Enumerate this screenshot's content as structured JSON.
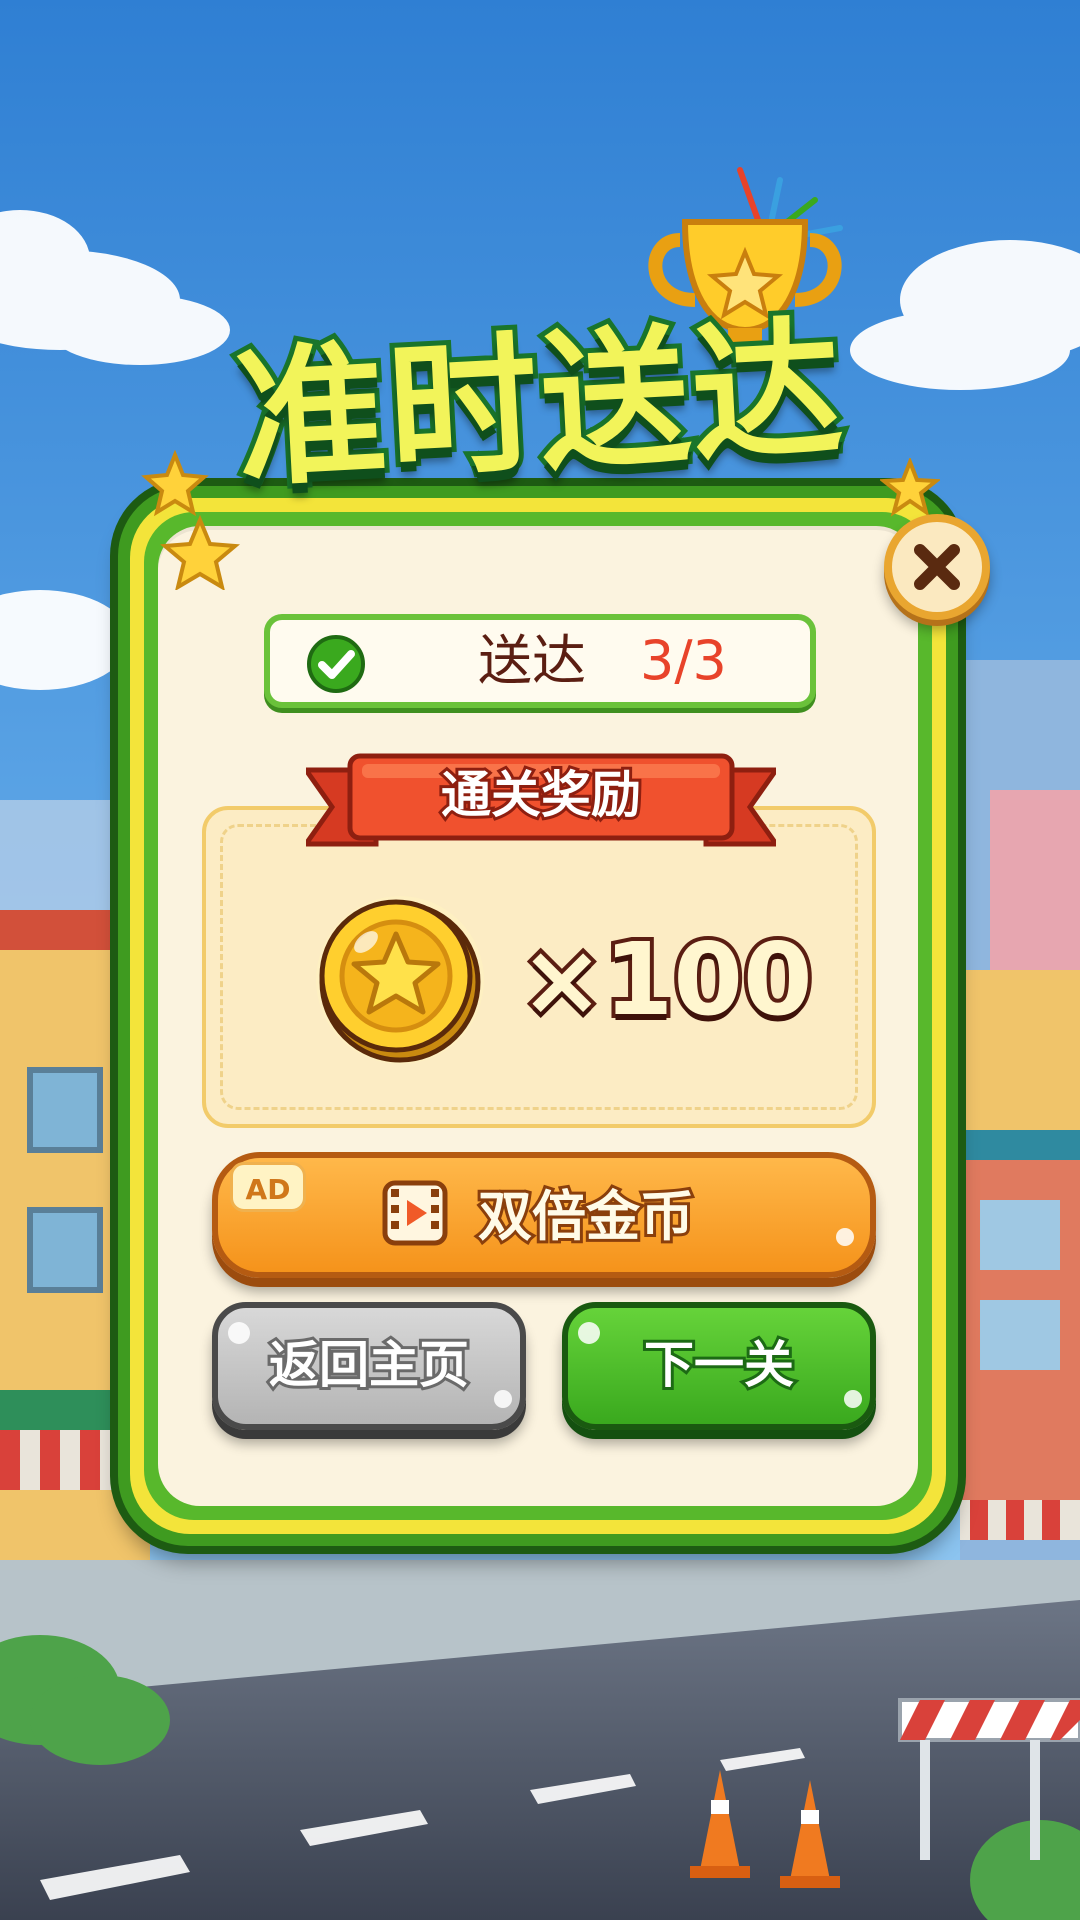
{
  "title": "准时送达",
  "status": {
    "label": "送达",
    "count": "3/3"
  },
  "reward": {
    "ribbon_label": "通关奖励",
    "amount": "×100"
  },
  "buttons": {
    "double": {
      "ad_badge": "AD",
      "label": "双倍金币"
    },
    "home": "返回主页",
    "next": "下一关"
  },
  "icons": {
    "close": "close-icon",
    "check": "check-icon",
    "coin": "star-coin-icon",
    "video": "video-play-icon",
    "trophy": "trophy-icon"
  },
  "colors": {
    "panel_green": "#58b82c",
    "panel_cream": "#fbf3df",
    "accent_orange": "#f5931b",
    "count_red": "#e8432a",
    "next_green": "#3aa91e",
    "home_gray": "#b4b4b4"
  }
}
